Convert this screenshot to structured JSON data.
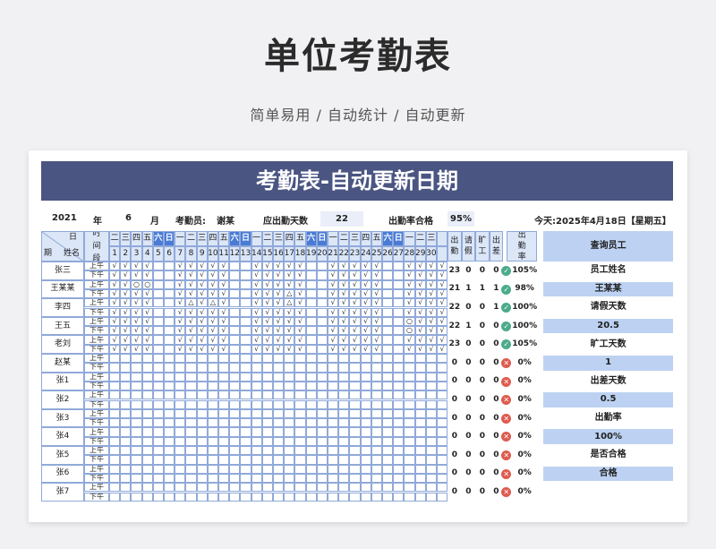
{
  "hero": {
    "title": "单位考勤表",
    "subtitle": "简单易用 / 自动统计 / 自动更新"
  },
  "sheet_title": "考勤表-自动更新日期",
  "info": {
    "year": "2021",
    "year_label": "年",
    "month": "6",
    "month_label": "月",
    "clerk_label": "考勤员:",
    "clerk": "谢某",
    "due_label": "应出勤天数",
    "due": "22",
    "rate_label": "出勤率合格",
    "rate": "95%",
    "today": "今天:2025年4月18日【星期五】"
  },
  "header": {
    "corner_day": "日",
    "corner_period": "期",
    "corner_name": "姓名",
    "time_label": "时间段",
    "out_label": "出勤",
    "leave_label": "请假",
    "absent_label": "旷工",
    "trip_label": "出差",
    "rate_label": "出勤率"
  },
  "weekdays": [
    "二",
    "三",
    "四",
    "五",
    "六",
    "日",
    "一",
    "二",
    "三",
    "四",
    "五",
    "六",
    "日",
    "一",
    "二",
    "三",
    "四",
    "五",
    "六",
    "日",
    "一",
    "二",
    "三",
    "四",
    "五",
    "六",
    "日",
    "一",
    "二",
    "三",
    ""
  ],
  "days": [
    "1",
    "2",
    "3",
    "4",
    "5",
    "6",
    "7",
    "8",
    "9",
    "10",
    "11",
    "12",
    "13",
    "14",
    "15",
    "16",
    "17",
    "18",
    "19",
    "20",
    "21",
    "22",
    "23",
    "24",
    "25",
    "26",
    "27",
    "28",
    "29",
    "30",
    ""
  ],
  "am": "上午",
  "pm": "下午",
  "rows": [
    {
      "name": "张三",
      "out": "23",
      "leave": "0",
      "absent": "0",
      "trip": "0",
      "rate": "105%",
      "status": "ok",
      "am": [
        "√",
        "√",
        "√",
        "√",
        "",
        "",
        "√",
        "√",
        "√",
        "√",
        "√",
        "",
        "",
        "√",
        "√",
        "√",
        "√",
        "√",
        "",
        "",
        "√",
        "√",
        "√",
        "√",
        "√",
        "",
        "",
        "√",
        "√",
        "√",
        "√"
      ],
      "pm": [
        "√",
        "√",
        "√",
        "√",
        "",
        "",
        "√",
        "√",
        "√",
        "√",
        "√",
        "",
        "",
        "√",
        "√",
        "√",
        "√",
        "√",
        "",
        "",
        "√",
        "√",
        "√",
        "√",
        "√",
        "",
        "",
        "√",
        "√",
        "√",
        "√"
      ]
    },
    {
      "name": "王某某",
      "out": "21",
      "leave": "1",
      "absent": "1",
      "trip": "1",
      "rate": "98%",
      "status": "ok",
      "am": [
        "√",
        "√",
        "○",
        "○",
        "",
        "",
        "√",
        "√",
        "√",
        "√",
        "√",
        "",
        "",
        "√",
        "√",
        "√",
        "√",
        "√",
        "",
        "",
        "√",
        "√",
        "√",
        "√",
        "√",
        "",
        "",
        "√",
        "√",
        "√",
        "√"
      ],
      "pm": [
        "√",
        "√",
        "√",
        "√",
        "",
        "",
        "√",
        "√",
        "√",
        "√",
        "√",
        "",
        "",
        "√",
        "√",
        "√",
        "△",
        "√",
        "",
        "",
        "√",
        "√",
        "√",
        "√",
        "√",
        "",
        "",
        "√",
        "√",
        "√",
        "√"
      ]
    },
    {
      "name": "李四",
      "out": "22",
      "leave": "0",
      "absent": "0",
      "trip": "1",
      "rate": "100%",
      "status": "ok",
      "am": [
        "√",
        "√",
        "√",
        "√",
        "",
        "",
        "√",
        "△",
        "√",
        "△",
        "√",
        "",
        "",
        "√",
        "√",
        "√",
        "△",
        "√",
        "",
        "",
        "√",
        "√",
        "√",
        "√",
        "√",
        "",
        "",
        "√",
        "√",
        "√",
        "√"
      ],
      "pm": [
        "√",
        "√",
        "√",
        "√",
        "",
        "",
        "√",
        "√",
        "√",
        "√",
        "√",
        "",
        "",
        "√",
        "√",
        "√",
        "√",
        "√",
        "",
        "",
        "√",
        "√",
        "√",
        "√",
        "√",
        "",
        "",
        "√",
        "√",
        "√",
        "√"
      ]
    },
    {
      "name": "王五",
      "out": "22",
      "leave": "1",
      "absent": "0",
      "trip": "0",
      "rate": "100%",
      "status": "ok",
      "am": [
        "√",
        "√",
        "√",
        "√",
        "",
        "",
        "√",
        "√",
        "√",
        "√",
        "√",
        "",
        "",
        "√",
        "√",
        "√",
        "√",
        "√",
        "",
        "",
        "√",
        "√",
        "√",
        "√",
        "√",
        "",
        "",
        "○",
        "√",
        "√",
        "√"
      ],
      "pm": [
        "√",
        "√",
        "√",
        "√",
        "",
        "",
        "√",
        "√",
        "√",
        "√",
        "√",
        "",
        "",
        "√",
        "√",
        "√",
        "√",
        "√",
        "",
        "",
        "√",
        "√",
        "√",
        "√",
        "√",
        "",
        "",
        "○",
        "√",
        "√",
        "√"
      ]
    },
    {
      "name": "老刘",
      "out": "23",
      "leave": "0",
      "absent": "0",
      "trip": "0",
      "rate": "105%",
      "status": "ok",
      "am": [
        "√",
        "√",
        "√",
        "√",
        "",
        "",
        "√",
        "√",
        "√",
        "√",
        "√",
        "",
        "",
        "√",
        "√",
        "√",
        "√",
        "√",
        "",
        "",
        "√",
        "√",
        "√",
        "√",
        "√",
        "",
        "",
        "√",
        "√",
        "√",
        "√"
      ],
      "pm": [
        "√",
        "√",
        "√",
        "√",
        "",
        "",
        "√",
        "√",
        "√",
        "√",
        "√",
        "",
        "",
        "√",
        "√",
        "√",
        "√",
        "√",
        "",
        "",
        "√",
        "√",
        "√",
        "√",
        "√",
        "",
        "",
        "√",
        "√",
        "√",
        "√"
      ]
    },
    {
      "name": "赵某",
      "out": "0",
      "leave": "0",
      "absent": "0",
      "trip": "0",
      "rate": "0%",
      "status": "no",
      "am": [],
      "pm": []
    },
    {
      "name": "张1",
      "out": "0",
      "leave": "0",
      "absent": "0",
      "trip": "0",
      "rate": "0%",
      "status": "no",
      "am": [],
      "pm": []
    },
    {
      "name": "张2",
      "out": "0",
      "leave": "0",
      "absent": "0",
      "trip": "0",
      "rate": "0%",
      "status": "no",
      "am": [],
      "pm": []
    },
    {
      "name": "张3",
      "out": "0",
      "leave": "0",
      "absent": "0",
      "trip": "0",
      "rate": "0%",
      "status": "no",
      "am": [],
      "pm": []
    },
    {
      "name": "张4",
      "out": "0",
      "leave": "0",
      "absent": "0",
      "trip": "0",
      "rate": "0%",
      "status": "no",
      "am": [],
      "pm": []
    },
    {
      "name": "张5",
      "out": "0",
      "leave": "0",
      "absent": "0",
      "trip": "0",
      "rate": "0%",
      "status": "no",
      "am": [],
      "pm": []
    },
    {
      "name": "张6",
      "out": "0",
      "leave": "0",
      "absent": "0",
      "trip": "0",
      "rate": "0%",
      "status": "no",
      "am": [],
      "pm": []
    },
    {
      "name": "张7",
      "out": "0",
      "leave": "0",
      "absent": "0",
      "trip": "0",
      "rate": "0%",
      "status": "no",
      "am": [],
      "pm": []
    }
  ],
  "side": [
    {
      "text": "查询员工",
      "style": "blue"
    },
    {
      "text": "员工姓名",
      "style": ""
    },
    {
      "text": "王某某",
      "style": "blue"
    },
    {
      "text": "请假天数",
      "style": ""
    },
    {
      "text": "20.5",
      "style": "blue"
    },
    {
      "text": "旷工天数",
      "style": ""
    },
    {
      "text": "1",
      "style": "blue"
    },
    {
      "text": "出差天数",
      "style": ""
    },
    {
      "text": "0.5",
      "style": "blue"
    },
    {
      "text": "出勤率",
      "style": ""
    },
    {
      "text": "100%",
      "style": "blue"
    },
    {
      "text": "是否合格",
      "style": ""
    },
    {
      "text": "合格",
      "style": "blue"
    }
  ],
  "icons": {
    "ok": "check-circle-icon",
    "no": "cross-circle-icon"
  },
  "colors": {
    "title_bg": "#4a5582",
    "header_bg": "#dbe6f7",
    "weekend": "#4a7cd6",
    "grid": "#90a9d9",
    "side_highlight": "#bdd2f2",
    "ok": "#4bab8a",
    "no": "#de5b4f"
  }
}
